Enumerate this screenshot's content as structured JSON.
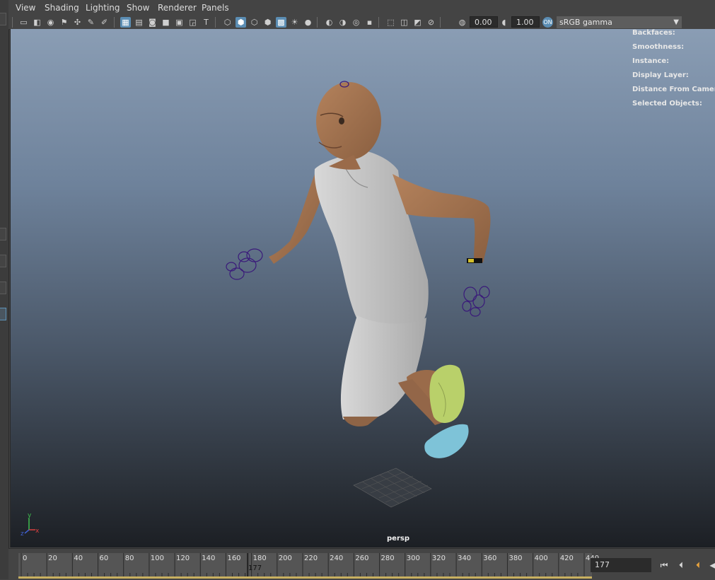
{
  "menu": {
    "items": [
      {
        "label": "View"
      },
      {
        "label": "Shading"
      },
      {
        "label": "Lighting"
      },
      {
        "label": "Show"
      },
      {
        "label": "Renderer"
      },
      {
        "label": "Panels"
      }
    ]
  },
  "toolbar": {
    "exposure_value": "0.00",
    "gamma_value": "1.00",
    "colorspace": "sRGB gamma"
  },
  "hud": [
    {
      "label": "Backfaces:"
    },
    {
      "label": "Smoothness:"
    },
    {
      "label": "Instance:"
    },
    {
      "label": "Display Layer:"
    },
    {
      "label": "Distance From Camera:"
    },
    {
      "label": "Selected Objects:"
    }
  ],
  "viewport": {
    "camera": "persp",
    "axis": {
      "x": "x",
      "y": "y",
      "z": "z"
    }
  },
  "timeline": {
    "ticks": [
      "0",
      "20",
      "40",
      "60",
      "80",
      "100",
      "120",
      "140",
      "160",
      "180",
      "200",
      "220",
      "240",
      "260",
      "280",
      "300",
      "320",
      "340",
      "360",
      "380",
      "400",
      "420",
      "440"
    ],
    "current_frame": "177",
    "frame_field": "177"
  },
  "colors": {
    "accent": "#5b8db3",
    "skin": "#a07352",
    "clothing": "#c9c9c9",
    "shoe_green": "#b9d06a",
    "shoe_blue": "#7ec3d8",
    "control_curves": "#3a1a7a"
  }
}
